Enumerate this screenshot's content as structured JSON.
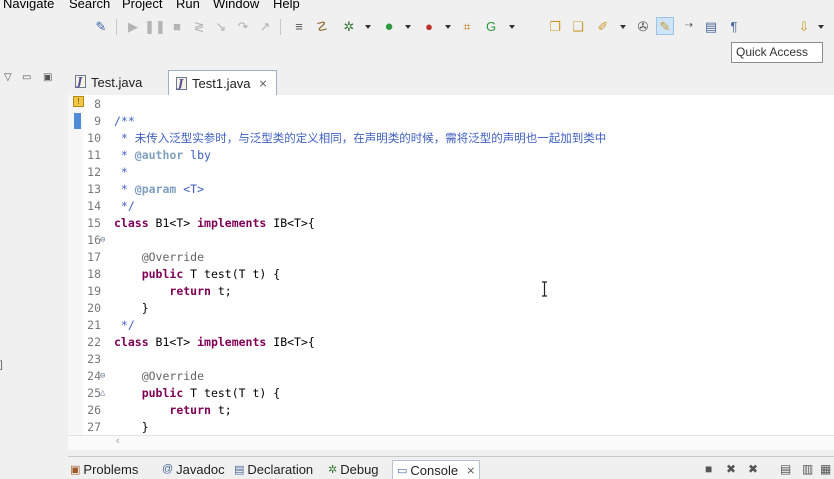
{
  "menu": [
    "Navigate",
    "Search",
    "Project",
    "Run",
    "Window",
    "Help"
  ],
  "toolbar_icons": [
    "skip-breakpoints-icon",
    "resume-icon",
    "suspend-icon",
    "terminate-icon",
    "disconnect-icon",
    "step-into-icon",
    "step-over-icon",
    "step-return-icon",
    "use-step-filters-icon",
    "toggle-comment-icon",
    "new-java-project-icon",
    "debug-icon",
    "run-icon",
    "external-tools-icon",
    "new-java-package-icon",
    "new-java-class-icon",
    "open-type-icon",
    "open-task-icon",
    "search-icon",
    "toggle-breadcrumb-icon",
    "toggle-mark-occurrences-icon",
    "toggle-block-selection-icon",
    "show-whitespace-icon",
    "next-annotation-icon"
  ],
  "quick_access": "Quick Access",
  "tabs": [
    {
      "label": "Test.java",
      "active": false
    },
    {
      "label": "Test1.java",
      "active": true
    }
  ],
  "close_glyph": "⨯",
  "code_lines": [
    {
      "num": "8",
      "fold": "",
      "segments": []
    },
    {
      "num": "9",
      "fold": "",
      "segments": [
        {
          "cls": "cm",
          "text": "/**"
        }
      ]
    },
    {
      "num": "10",
      "fold": "",
      "segments": [
        {
          "cls": "cm",
          "text": " * 未传入泛型实参时，与泛型类的定义相同，在声明类的时候，需将泛型的声明也一起加到类中"
        }
      ]
    },
    {
      "num": "11",
      "fold": "",
      "segments": [
        {
          "cls": "cm",
          "text": " * "
        },
        {
          "cls": "tag",
          "text": "@author"
        },
        {
          "cls": "cm",
          "text": " lby"
        }
      ]
    },
    {
      "num": "12",
      "fold": "",
      "segments": [
        {
          "cls": "cm",
          "text": " *"
        }
      ]
    },
    {
      "num": "13",
      "fold": "",
      "segments": [
        {
          "cls": "cm",
          "text": " * "
        },
        {
          "cls": "tag",
          "text": "@param"
        },
        {
          "cls": "cm",
          "text": " <T>"
        }
      ]
    },
    {
      "num": "14",
      "fold": "",
      "segments": [
        {
          "cls": "cm",
          "text": " */"
        }
      ]
    },
    {
      "num": "15",
      "fold": "",
      "segments": [
        {
          "cls": "kw",
          "text": "class"
        },
        {
          "cls": "pl",
          "text": " B1<T> "
        },
        {
          "cls": "kw",
          "text": "implements"
        },
        {
          "cls": "pl",
          "text": " IB<T>{"
        }
      ]
    },
    {
      "num": "16",
      "fold": "⊖",
      "segments": []
    },
    {
      "num": "17",
      "fold": "",
      "segments": [
        {
          "cls": "an",
          "text": "    @Override"
        }
      ]
    },
    {
      "num": "18",
      "fold": "",
      "segments": [
        {
          "cls": "pl",
          "text": "    "
        },
        {
          "cls": "kw",
          "text": "public"
        },
        {
          "cls": "pl",
          "text": " T test(T t) {"
        }
      ]
    },
    {
      "num": "19",
      "fold": "",
      "segments": [
        {
          "cls": "pl",
          "text": "        "
        },
        {
          "cls": "kw",
          "text": "return"
        },
        {
          "cls": "pl",
          "text": " t;"
        }
      ]
    },
    {
      "num": "20",
      "fold": "",
      "segments": [
        {
          "cls": "pl",
          "text": "    }"
        }
      ]
    },
    {
      "num": "21",
      "fold": "",
      "segments": [
        {
          "cls": "cm",
          "text": " */"
        }
      ]
    },
    {
      "num": "22",
      "fold": "",
      "segments": [
        {
          "cls": "kw",
          "text": "class"
        },
        {
          "cls": "pl",
          "text": " B1<T> "
        },
        {
          "cls": "kw",
          "text": "implements"
        },
        {
          "cls": "pl",
          "text": " IB<T>{"
        }
      ]
    },
    {
      "num": "23",
      "fold": "",
      "segments": []
    },
    {
      "num": "24",
      "fold": "⊖",
      "segments": [
        {
          "cls": "an",
          "text": "    @Override"
        }
      ]
    },
    {
      "num": "25",
      "fold": "△",
      "segments": [
        {
          "cls": "pl",
          "text": "    "
        },
        {
          "cls": "kw",
          "text": "public"
        },
        {
          "cls": "pl",
          "text": " T test(T t) {"
        }
      ]
    },
    {
      "num": "26",
      "fold": "",
      "segments": [
        {
          "cls": "pl",
          "text": "        "
        },
        {
          "cls": "kw",
          "text": "return"
        },
        {
          "cls": "pl",
          "text": " t;"
        }
      ]
    },
    {
      "num": "27",
      "fold": "",
      "segments": [
        {
          "cls": "pl",
          "text": "    }"
        }
      ]
    }
  ],
  "bottom_tabs": [
    {
      "label": "Problems",
      "icon": "problems-icon",
      "glyph": "▣"
    },
    {
      "label": "Javadoc",
      "icon": "javadoc-icon",
      "glyph": "@"
    },
    {
      "label": "Declaration",
      "icon": "declaration-icon",
      "glyph": "▤"
    },
    {
      "label": "Debug",
      "icon": "debug-icon",
      "glyph": "✲"
    },
    {
      "label": "Console",
      "icon": "console-icon",
      "glyph": "▭",
      "active": true
    }
  ],
  "colors": {
    "comment": "#3f5fbf",
    "keyword": "#7f0055",
    "annotation": "#646464",
    "javadoc_tag": "#7f9fbf"
  }
}
